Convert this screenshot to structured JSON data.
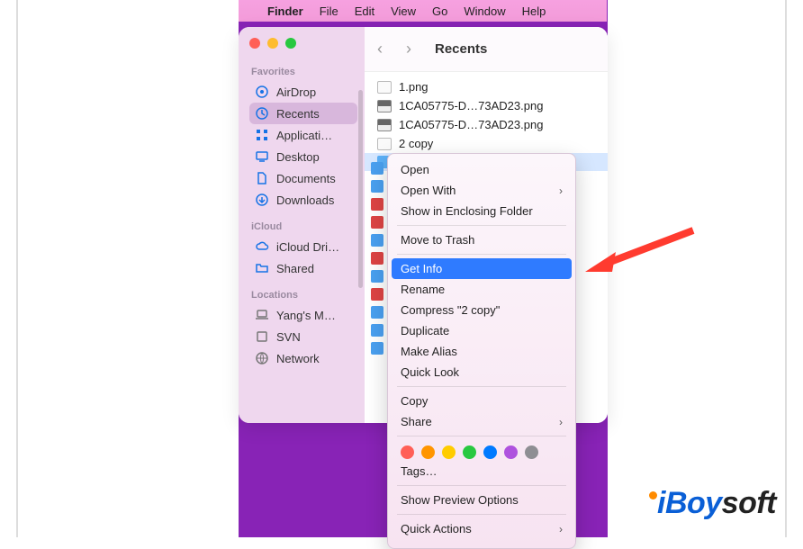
{
  "menubar": {
    "app": "Finder",
    "items": [
      "File",
      "Edit",
      "View",
      "Go",
      "Window",
      "Help"
    ]
  },
  "window": {
    "title": "Recents"
  },
  "sidebar": {
    "sections": [
      {
        "title": "Favorites",
        "items": [
          {
            "icon": "airdrop",
            "label": "AirDrop"
          },
          {
            "icon": "clock",
            "label": "Recents",
            "selected": true
          },
          {
            "icon": "apps",
            "label": "Applicati…"
          },
          {
            "icon": "desktop",
            "label": "Desktop"
          },
          {
            "icon": "doc",
            "label": "Documents"
          },
          {
            "icon": "download",
            "label": "Downloads"
          }
        ]
      },
      {
        "title": "iCloud",
        "items": [
          {
            "icon": "cloud",
            "label": "iCloud Dri…"
          },
          {
            "icon": "folder",
            "label": "Shared"
          }
        ]
      },
      {
        "title": "Locations",
        "items": [
          {
            "icon": "laptop",
            "label": "Yang's M…"
          },
          {
            "icon": "disk",
            "label": "SVN"
          },
          {
            "icon": "globe",
            "label": "Network"
          }
        ]
      }
    ]
  },
  "files": [
    {
      "kind": "blank",
      "name": "1.png"
    },
    {
      "kind": "photo",
      "name": "1CA05775-D…73AD23.png"
    },
    {
      "kind": "photo",
      "name": "1CA05775-D…73AD23.png"
    },
    {
      "kind": "blank",
      "name": "2 copy"
    }
  ],
  "context_menu": {
    "groups": [
      [
        {
          "label": "Open"
        },
        {
          "label": "Open With",
          "submenu": true
        },
        {
          "label": "Show in Enclosing Folder"
        }
      ],
      [
        {
          "label": "Move to Trash"
        }
      ],
      [
        {
          "label": "Get Info",
          "highlight": true
        },
        {
          "label": "Rename"
        },
        {
          "label": "Compress \"2 copy\""
        },
        {
          "label": "Duplicate"
        },
        {
          "label": "Make Alias"
        },
        {
          "label": "Quick Look"
        }
      ],
      [
        {
          "label": "Copy"
        },
        {
          "label": "Share",
          "submenu": true
        }
      ]
    ],
    "tag_colors": [
      "#ff5f57",
      "#ff9500",
      "#ffcc00",
      "#28c840",
      "#007aff",
      "#af52de",
      "#8e8e93"
    ],
    "tags_label": "Tags…",
    "preview_label": "Show Preview Options",
    "quick_actions_label": "Quick Actions"
  },
  "watermark": {
    "part1": "i",
    "part2": "Boy",
    "part3": "soft"
  }
}
